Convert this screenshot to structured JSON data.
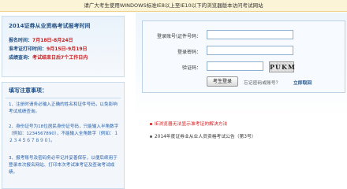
{
  "notice": "请广大考生使用WINDOWS标准IE8以上至IE10以下的浏览器版本访问考试网站",
  "schedule": {
    "title": "2014证券从业资格考试报考时间",
    "rows": [
      {
        "label": "报名时间：",
        "value": "7月18日-8月24日"
      },
      {
        "label": "准考证打印时间：",
        "value": "9月15日-9月19日"
      },
      {
        "label": "成绩查询：",
        "value": "考试结束日后7个工作日内"
      }
    ]
  },
  "tips": {
    "title": "填写注意事项：",
    "items": [
      "1、注册时请务必输入正确的姓名和证件号码，以免影响考试成绩查询。",
      "2、身份证号为18位居民身份证号码，只能输入半角数字（例如：1234567890），不能输入全角数字（例如：１２３４５６７８９０）。",
      "3、报考账号及密码务必牢记并妥善保存，以便后续用于登录本次报名网站、打印本次考试准考证及查询考试成绩。"
    ]
  },
  "login": {
    "account_label": "登录账号\\证件号码：",
    "password_label": "登录密码：",
    "captcha_label": "验证码：",
    "captcha_text": "PUKM",
    "account_value": "",
    "password_value": "",
    "captcha_value": "",
    "submit_label": "考生登录",
    "forgot_label": "忘记密码或账号？",
    "reset_label": "立即取回"
  },
  "news": [
    {
      "text": "IE浏览器无法显示准考证的解决方法",
      "highlight": true
    },
    {
      "text": "2014年度证券业从业人员资格考试公告（第3号）",
      "highlight": false
    }
  ],
  "colors": {
    "notice_bg": "#fbf4d6",
    "panel_title": "#1f4f86",
    "date_red": "#c81f1f",
    "tip_blue": "#2860a8",
    "news_red": "#d21a1a"
  }
}
